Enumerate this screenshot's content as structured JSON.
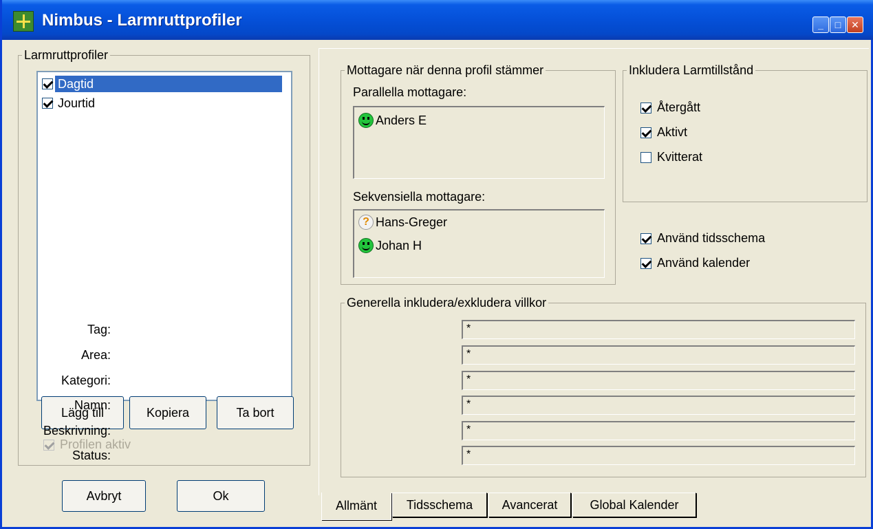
{
  "window": {
    "title": "Nimbus - Larmruttprofiler",
    "minimize_icon": "minimize-icon",
    "maximize_icon": "maximize-icon",
    "close_icon": "close-icon"
  },
  "profiles": {
    "group_label": "Larmruttprofiler",
    "items": [
      {
        "label": "Dagtid",
        "checked": true,
        "selected": true
      },
      {
        "label": "Jourtid",
        "checked": true,
        "selected": false
      }
    ],
    "add_button": "Lägg till",
    "copy_button": "Kopiera",
    "remove_button": "Ta bort",
    "active_label": "Profilen aktiv",
    "active_checked": true,
    "active_enabled": false
  },
  "footer": {
    "cancel_button": "Avbryt",
    "ok_button": "Ok"
  },
  "recipients": {
    "group_label": "Mottagare när denna profil stämmer",
    "parallel_label": "Parallella mottagare:",
    "parallel": [
      {
        "name": "Anders E",
        "status_icon": "smiley-green-icon"
      }
    ],
    "sequential_label": "Sekvensiella mottagare:",
    "sequential": [
      {
        "name": "Hans-Greger",
        "status_icon": "question-icon"
      },
      {
        "name": "Johan H",
        "status_icon": "smiley-green-icon"
      }
    ]
  },
  "alarm_states": {
    "group_label": "Inkludera Larmtillstånd",
    "items": [
      {
        "label": "Återgått",
        "checked": true
      },
      {
        "label": "Aktivt",
        "checked": true
      },
      {
        "label": "Kvitterat",
        "checked": false
      }
    ]
  },
  "options": {
    "use_schedule": "Använd tidsschema",
    "use_schedule_checked": true,
    "use_calendar": "Använd kalender",
    "use_calendar_checked": true
  },
  "conditions": {
    "group_label": "Generella inkludera/exkludera villkor",
    "fields": [
      {
        "label": "Tag:",
        "value": "*"
      },
      {
        "label": "Area:",
        "value": "*"
      },
      {
        "label": "Kategori:",
        "value": "*"
      },
      {
        "label": "Namn:",
        "value": "*"
      },
      {
        "label": "Beskrivning:",
        "value": "*"
      },
      {
        "label": "Status:",
        "value": "*"
      }
    ]
  },
  "tabs": [
    {
      "label": "Allmänt",
      "active": true
    },
    {
      "label": "Tidsschema",
      "active": false
    },
    {
      "label": "Avancerat",
      "active": false
    },
    {
      "label": "Global Kalender",
      "active": false
    }
  ],
  "colors": {
    "titlebar": "#0550d8",
    "selection": "#316ac5",
    "dialog_bg": "#ece9d8"
  }
}
